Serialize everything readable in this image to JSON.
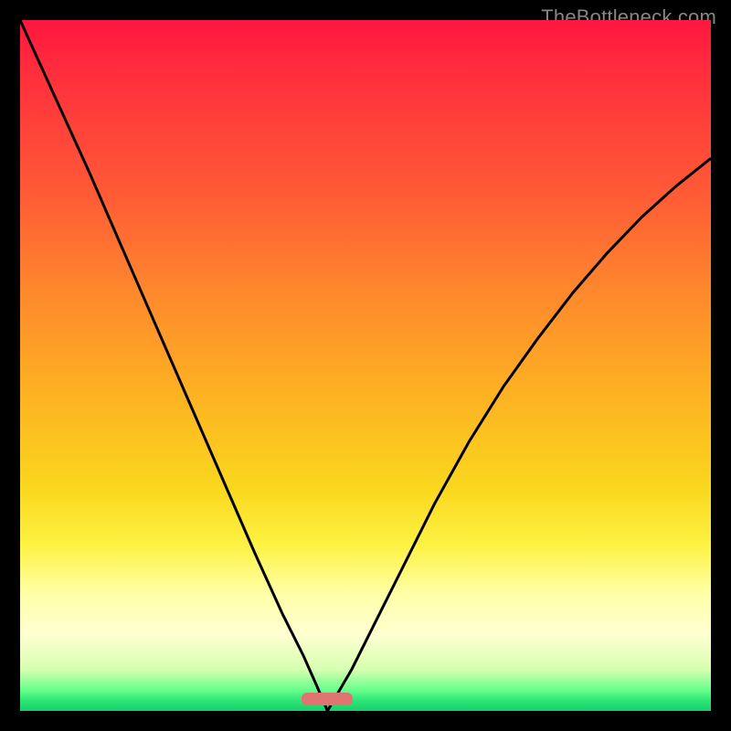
{
  "attribution": "TheBottleneck.com",
  "marker": {
    "x_center_frac": 0.445,
    "y_frac": 0.983,
    "width_frac": 0.074,
    "height_frac": 0.018,
    "color": "#E07470"
  },
  "chart_data": {
    "type": "line",
    "title": "",
    "xlabel": "",
    "ylabel": "",
    "xlim": [
      0,
      1
    ],
    "ylim": [
      0,
      1
    ],
    "note": "Axis-less bottleneck curve; x is normalized horizontal position, y is normalized height of black curve from plot bottom. Two branches form a cusp near x≈0.445 where y≈0 (minimum, the marker's location).",
    "series": [
      {
        "name": "left-branch",
        "x": [
          0.0,
          0.05,
          0.1,
          0.15,
          0.2,
          0.25,
          0.3,
          0.34,
          0.38,
          0.41,
          0.43,
          0.445
        ],
        "y": [
          1.0,
          0.89,
          0.78,
          0.665,
          0.55,
          0.435,
          0.32,
          0.228,
          0.14,
          0.08,
          0.035,
          0.0
        ]
      },
      {
        "name": "right-branch",
        "x": [
          0.445,
          0.48,
          0.52,
          0.56,
          0.6,
          0.65,
          0.7,
          0.75,
          0.8,
          0.85,
          0.9,
          0.95,
          1.0
        ],
        "y": [
          0.0,
          0.06,
          0.14,
          0.22,
          0.3,
          0.39,
          0.47,
          0.54,
          0.605,
          0.663,
          0.715,
          0.76,
          0.8
        ]
      }
    ],
    "gradient_stops": [
      {
        "pos": 0.0,
        "color": "#ff173f"
      },
      {
        "pos": 0.25,
        "color": "#ff5a36"
      },
      {
        "pos": 0.55,
        "color": "#fdb422"
      },
      {
        "pos": 0.76,
        "color": "#fef243"
      },
      {
        "pos": 0.89,
        "color": "#ffffd2"
      },
      {
        "pos": 0.97,
        "color": "#66ff8a"
      },
      {
        "pos": 1.0,
        "color": "#18d06a"
      }
    ]
  }
}
